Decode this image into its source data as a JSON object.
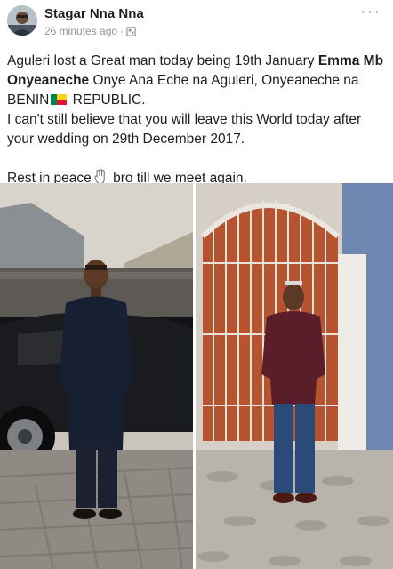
{
  "post": {
    "author": "Stagar Nna Nna",
    "timestamp": "26 minutes ago",
    "separator": "·",
    "privacy_icon": "globe-icon",
    "more_label": "···",
    "text": {
      "line1_a": "Aguleri lost a Great man today being 19th January ",
      "line1_bold": "Emma Mb Onyeaneche",
      "line1_b": " Onye Ana Eche na Aguleri, Onyeaneche na BENIN",
      "line1_c": " REPUBLIC.",
      "line2": "I can't still believe that you will leave this World today after your wedding on 29th December 2017.",
      "line3_a": "Rest in peace",
      "line3_b": " bro till we meet again."
    },
    "flag_icon": "benin-flag-icon",
    "hand_icon": "hand-icon",
    "photos": [
      "man-by-car-photo",
      "man-by-gate-photo"
    ],
    "colors": {
      "name": "#1c1e21",
      "meta": "#8d949e",
      "flag_green": "#008751",
      "flag_yellow": "#fcd116",
      "flag_red": "#e8112d"
    }
  }
}
